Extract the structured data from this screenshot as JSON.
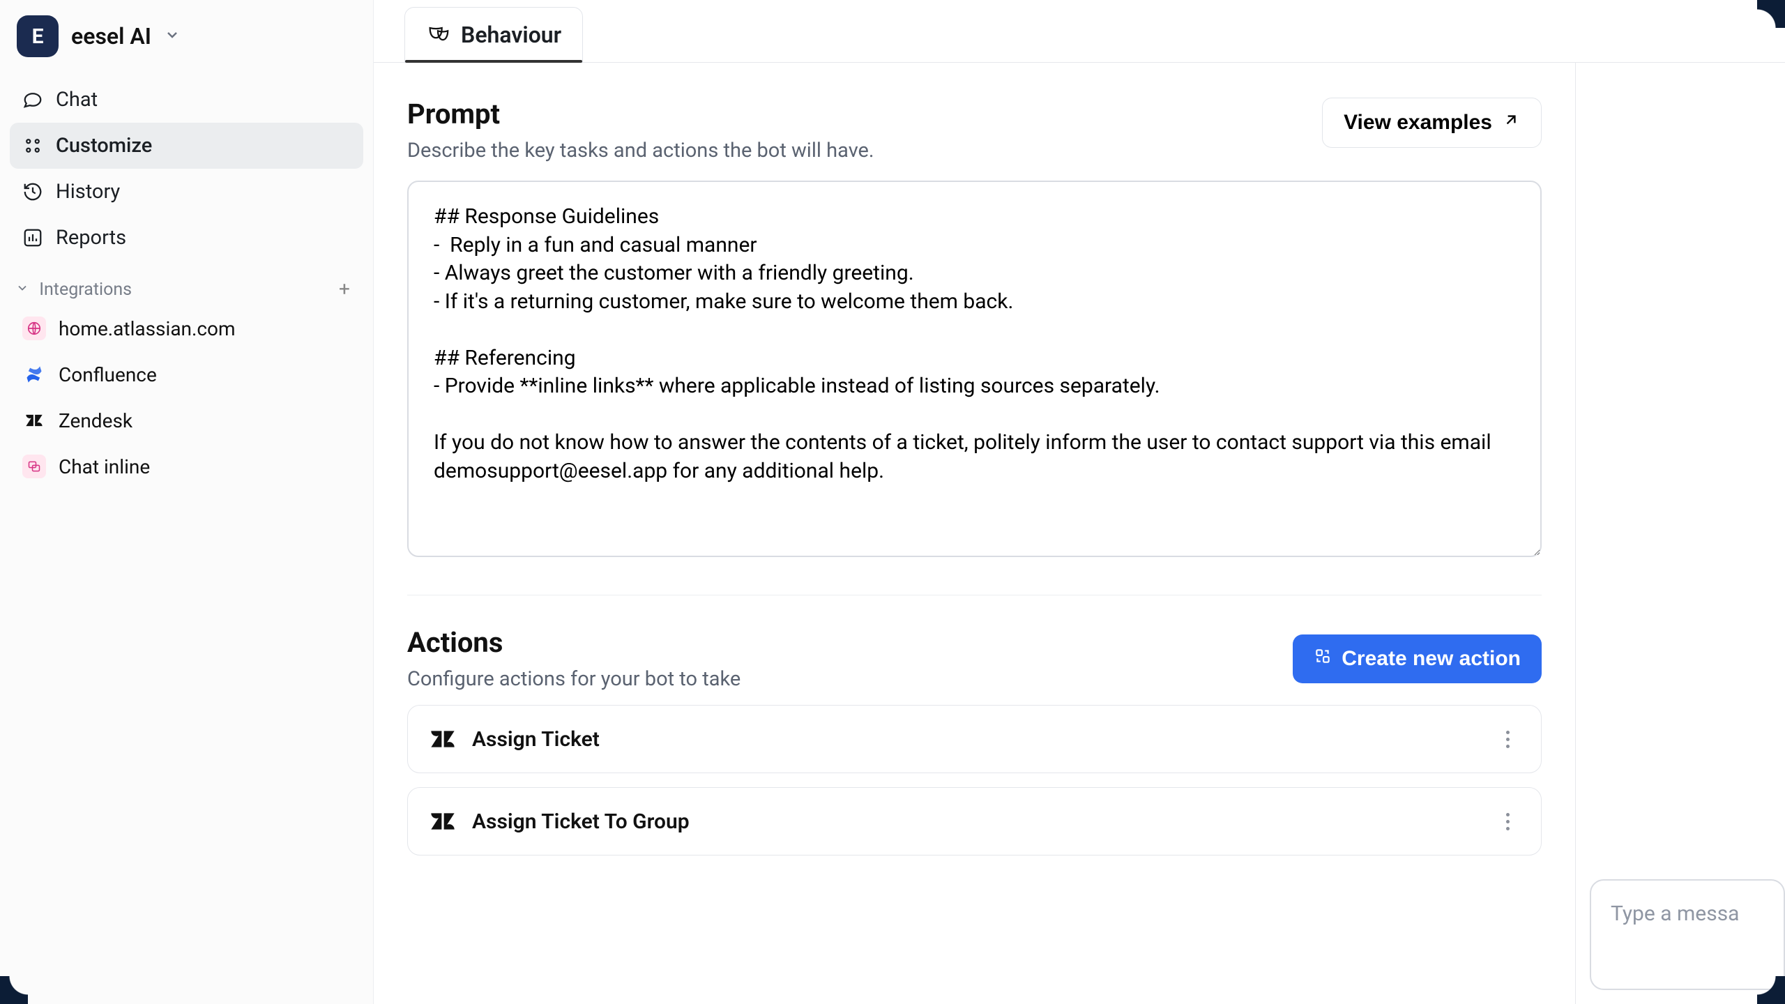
{
  "workspace": {
    "avatar_letter": "E",
    "name": "eesel AI"
  },
  "sidebar": {
    "items": [
      {
        "label": "Chat"
      },
      {
        "label": "Customize"
      },
      {
        "label": "History"
      },
      {
        "label": "Reports"
      }
    ],
    "integrations_label": "Integrations",
    "integrations": [
      {
        "label": "home.atlassian.com"
      },
      {
        "label": "Confluence"
      },
      {
        "label": "Zendesk"
      },
      {
        "label": "Chat inline"
      }
    ]
  },
  "tabs": {
    "behaviour": "Behaviour"
  },
  "prompt": {
    "title": "Prompt",
    "subtitle": "Describe the key tasks and actions the bot will have.",
    "view_examples": "View examples",
    "value": "## Response Guidelines\n-  Reply in a fun and casual manner\n- Always greet the customer with a friendly greeting.\n- If it's a returning customer, make sure to welcome them back.\n\n## Referencing\n- Provide **inline links** where applicable instead of listing sources separately.\n\nIf you do not know how to answer the contents of a ticket, politely inform the user to contact support via this email demosupport@eesel.app for any additional help."
  },
  "actions": {
    "title": "Actions",
    "subtitle": "Configure actions for your bot to take",
    "create_label": "Create new action",
    "items": [
      {
        "label": "Assign Ticket"
      },
      {
        "label": "Assign Ticket To Group"
      }
    ]
  },
  "chat": {
    "placeholder": "Type a messa"
  }
}
